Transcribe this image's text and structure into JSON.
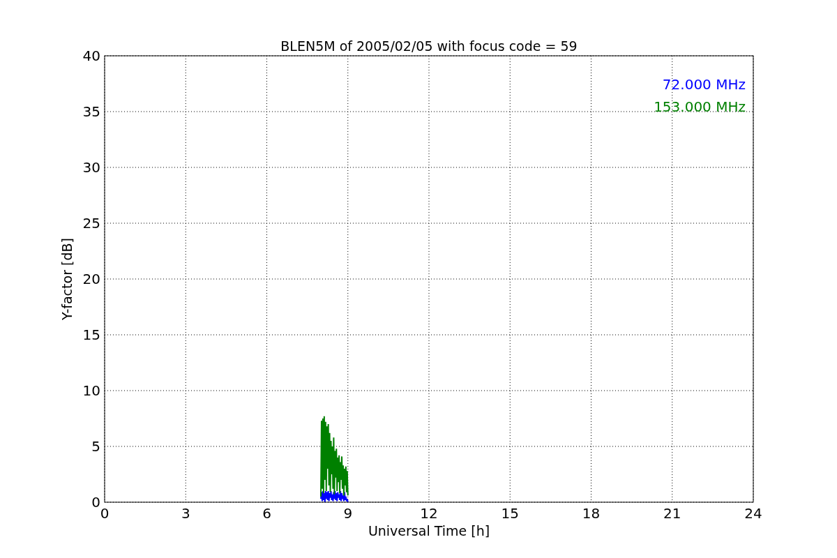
{
  "chart_data": {
    "type": "line",
    "title": "BLEN5M of 2005/02/05 with focus code = 59",
    "xlabel": "Universal Time [h]",
    "ylabel": "Y-factor [dB]",
    "x": [
      8.0,
      8.025,
      8.05,
      8.075,
      8.1,
      8.125,
      8.15,
      8.175,
      8.2,
      8.225,
      8.25,
      8.275,
      8.3,
      8.325,
      8.35,
      8.375,
      8.4,
      8.425,
      8.45,
      8.475,
      8.5,
      8.525,
      8.55,
      8.575,
      8.6,
      8.625,
      8.65,
      8.675,
      8.7,
      8.725,
      8.75,
      8.775,
      8.8,
      8.825,
      8.85,
      8.875,
      8.9,
      8.925,
      8.95,
      8.975,
      9.0
    ],
    "series": [
      {
        "name": "72.000 MHz",
        "color": "#0000ff",
        "values": [
          0.3,
          0.9,
          0.1,
          1.0,
          0.2,
          0.8,
          0.0,
          1.0,
          0.3,
          0.9,
          0.2,
          1.0,
          0.1,
          0.8,
          0.4,
          1.0,
          0.2,
          0.7,
          0.1,
          0.9,
          0.3,
          1.0,
          0.2,
          0.8,
          0.1,
          0.9,
          0.4,
          0.7,
          0.2,
          1.0,
          0.1,
          0.8,
          0.3,
          0.6,
          0.1,
          0.9,
          0.2,
          0.5,
          0.1,
          0.3,
          0.0
        ]
      },
      {
        "name": "153.000 MHz",
        "color": "#008000",
        "values": [
          0.5,
          7.3,
          1.2,
          7.5,
          0.8,
          7.7,
          2.0,
          7.2,
          1.0,
          6.8,
          3.0,
          7.0,
          1.5,
          6.2,
          0.9,
          5.5,
          2.5,
          5.0,
          1.2,
          5.8,
          0.7,
          4.6,
          2.2,
          4.8,
          1.0,
          4.0,
          1.8,
          4.2,
          0.8,
          3.6,
          2.0,
          4.1,
          1.2,
          3.3,
          0.6,
          3.0,
          1.5,
          3.2,
          0.9,
          2.8,
          0.6
        ]
      }
    ],
    "grid": true,
    "xlim": [
      0,
      24
    ],
    "ylim": [
      0,
      40
    ],
    "xticks": [
      0,
      3,
      6,
      9,
      12,
      15,
      18,
      21,
      24
    ],
    "yticks": [
      0,
      5,
      10,
      15,
      20,
      25,
      30,
      35,
      40
    ]
  }
}
